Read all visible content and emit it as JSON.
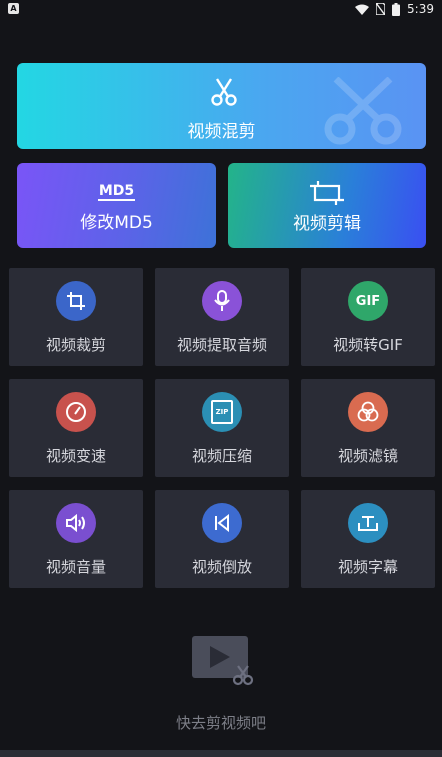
{
  "status_bar": {
    "time": "5:39"
  },
  "top_cards": {
    "mix": {
      "label": "视频混剪"
    },
    "md5": {
      "mark": "MD5",
      "label": "修改MD5"
    },
    "edit": {
      "label": "视频剪辑"
    }
  },
  "tools": [
    {
      "label": "视频裁剪",
      "icon": "crop-icon",
      "color": "#3b66c9"
    },
    {
      "label": "视频提取音频",
      "icon": "microphone-icon",
      "color": "#8a52d8"
    },
    {
      "label": "视频转GIF",
      "icon": "gif-icon",
      "color": "#2fa76a",
      "icon_text": "GIF"
    },
    {
      "label": "视频变速",
      "icon": "speed-gauge-icon",
      "color": "#c8524d"
    },
    {
      "label": "视频压缩",
      "icon": "zip-icon",
      "color": "#2b8fb4",
      "icon_text": "ZIP"
    },
    {
      "label": "视频滤镜",
      "icon": "filter-icon",
      "color": "#d96b50"
    },
    {
      "label": "视频音量",
      "icon": "volume-icon",
      "color": "#7a4fd0"
    },
    {
      "label": "视频倒放",
      "icon": "reverse-play-icon",
      "color": "#3d6bd0"
    },
    {
      "label": "视频字幕",
      "icon": "subtitle-icon",
      "color": "#2c8fc0"
    }
  ],
  "empty_state": {
    "text": "快去剪视频吧",
    "icon": "video-scissors-icon"
  }
}
